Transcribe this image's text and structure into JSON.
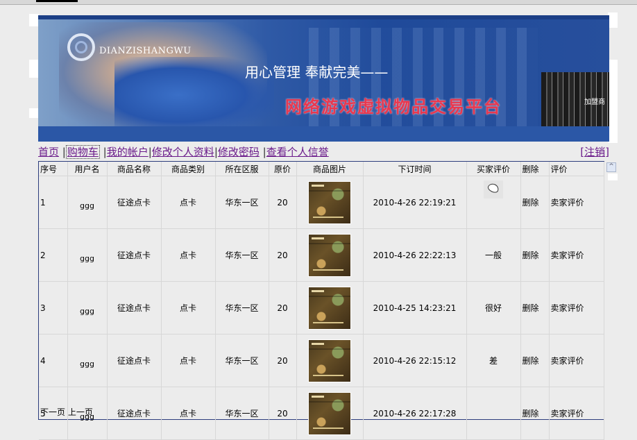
{
  "banner": {
    "logo_text": "DIANZISHANGWU",
    "slogan": "用心管理 奉献完美——",
    "subtitle": "网络游戏虚拟物品交易平台",
    "books_label": "加盟商"
  },
  "nav": {
    "home": "首页",
    "cart": "购物车",
    "account": "我的帐户",
    "edit_profile": "修改个人资料",
    "change_password": "修改密码",
    "reputation": "查看个人信誉",
    "logout": "[注销]"
  },
  "table": {
    "headers": [
      "序号",
      "用户名",
      "商品名称",
      "商品类别",
      "所在区服",
      "原价",
      "商品图片",
      "下订时间",
      "买家评价",
      "删除",
      "评价"
    ],
    "rows": [
      {
        "no": "1",
        "user": "ggg",
        "name": "征途点卡",
        "category": "点卡",
        "server": "华东一区",
        "price": "20",
        "time": "2010-4-26 22:19:21",
        "rating": "",
        "delete": "删除",
        "review": "卖家评价"
      },
      {
        "no": "2",
        "user": "ggg",
        "name": "征途点卡",
        "category": "点卡",
        "server": "华东一区",
        "price": "20",
        "time": "2010-4-26 22:22:13",
        "rating": "一般",
        "delete": "删除",
        "review": "卖家评价"
      },
      {
        "no": "3",
        "user": "ggg",
        "name": "征途点卡",
        "category": "点卡",
        "server": "华东一区",
        "price": "20",
        "time": "2010-4-25 14:23:21",
        "rating": "很好",
        "delete": "删除",
        "review": "卖家评价"
      },
      {
        "no": "4",
        "user": "ggg",
        "name": "征途点卡",
        "category": "点卡",
        "server": "华东一区",
        "price": "20",
        "time": "2010-4-26 22:15:12",
        "rating": "差",
        "delete": "删除",
        "review": "卖家评价"
      },
      {
        "no": "5",
        "user": "ggg",
        "name": "征途点卡",
        "category": "点卡",
        "server": "华东一区",
        "price": "20",
        "time": "2010-4-26 22:17:28",
        "rating": "",
        "delete": "删除",
        "review": "卖家评价"
      }
    ]
  },
  "pager": {
    "next": "下一页",
    "prev": "上一页"
  }
}
